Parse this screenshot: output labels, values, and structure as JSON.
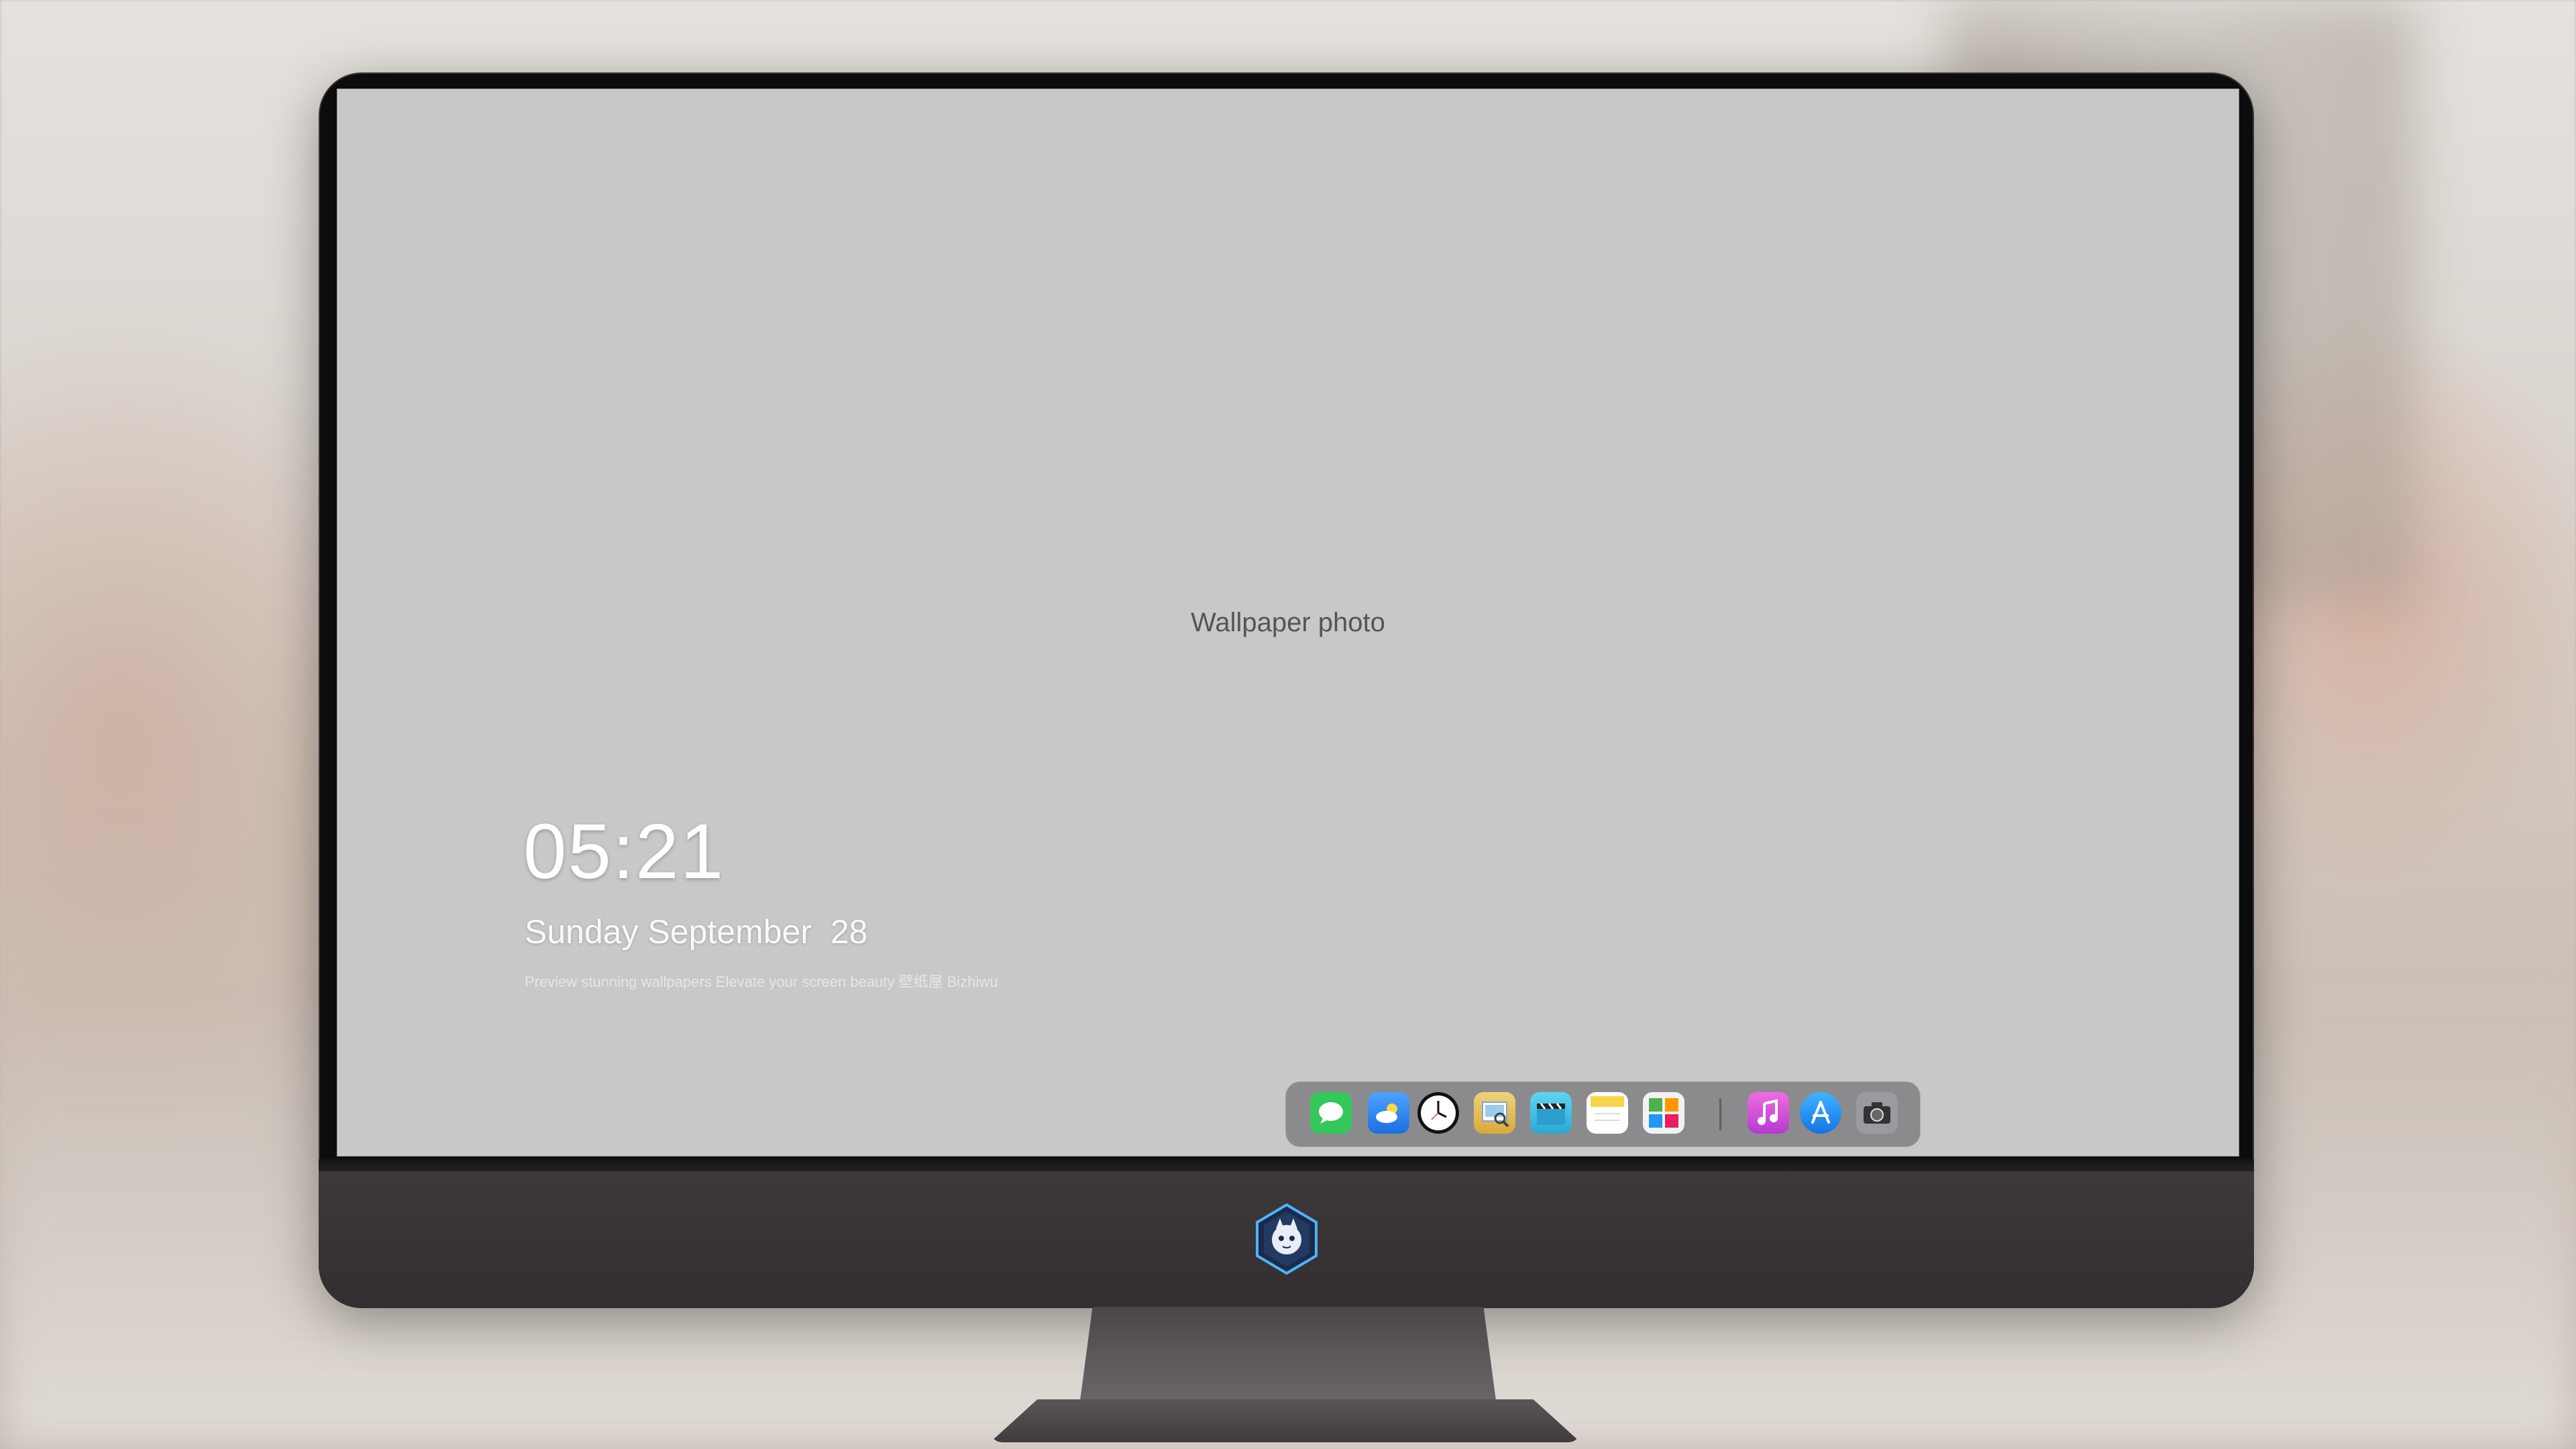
{
  "lockscreen": {
    "time": "05:21",
    "date": "Sunday September  28",
    "tagline": "Preview stunning wallpapers Elevate your screen beauty   壁纸屋   Bizhiwu"
  },
  "dock": {
    "items": [
      {
        "icon": "messages-icon",
        "label": "Messages",
        "color": "#34c759"
      },
      {
        "icon": "weather-icon",
        "label": "Weather",
        "color": "#3a8ff0"
      },
      {
        "icon": "clock-icon",
        "label": "Clock",
        "color": "#1c1c1e"
      },
      {
        "icon": "preview-icon",
        "label": "Preview",
        "color": "#e9c86a"
      },
      {
        "icon": "video-icon",
        "label": "Videos",
        "color": "#3cc3e6"
      },
      {
        "icon": "notes-icon",
        "label": "Notes",
        "color": "#f7d44a"
      },
      {
        "icon": "photo-gallery-icon",
        "label": "Gallery",
        "color": "#e8e8e8"
      },
      {
        "icon": "music-icon",
        "label": "iTunes",
        "color": "#d64bd9"
      },
      {
        "icon": "app-store-icon",
        "label": "App Store",
        "color": "#1f8ff5"
      },
      {
        "icon": "camera-icon",
        "label": "Camera",
        "color": "#8e8e93"
      }
    ]
  },
  "wallpaper": {
    "label": "Wallpaper photo"
  }
}
